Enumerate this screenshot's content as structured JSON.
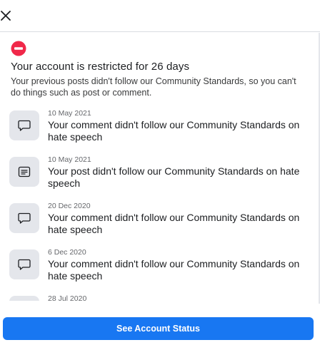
{
  "header": {
    "close_icon": "close-icon"
  },
  "restriction": {
    "icon": "no-entry-icon",
    "icon_color": "#f02849",
    "title": "Your account is restricted for 26 days",
    "description": "Your previous posts didn't follow our Community Standards, so you can't do things such as post or comment."
  },
  "violations": [
    {
      "icon": "comment-icon",
      "date": "10 May 2021",
      "text": "Your comment didn't follow our Community Standards on hate speech"
    },
    {
      "icon": "post-icon",
      "date": "10 May 2021",
      "text": "Your post didn't follow our Community Standards on hate speech"
    },
    {
      "icon": "comment-icon",
      "date": "20 Dec 2020",
      "text": "Your comment didn't follow our Community Standards on hate speech"
    },
    {
      "icon": "comment-icon",
      "date": "6 Dec 2020",
      "text": "Your comment didn't follow our Community Standards on hate speech"
    },
    {
      "icon": "comment-icon",
      "date": "28 Jul 2020",
      "text": ""
    }
  ],
  "footer": {
    "button_label": "See Account Status",
    "button_color": "#1877f2"
  }
}
